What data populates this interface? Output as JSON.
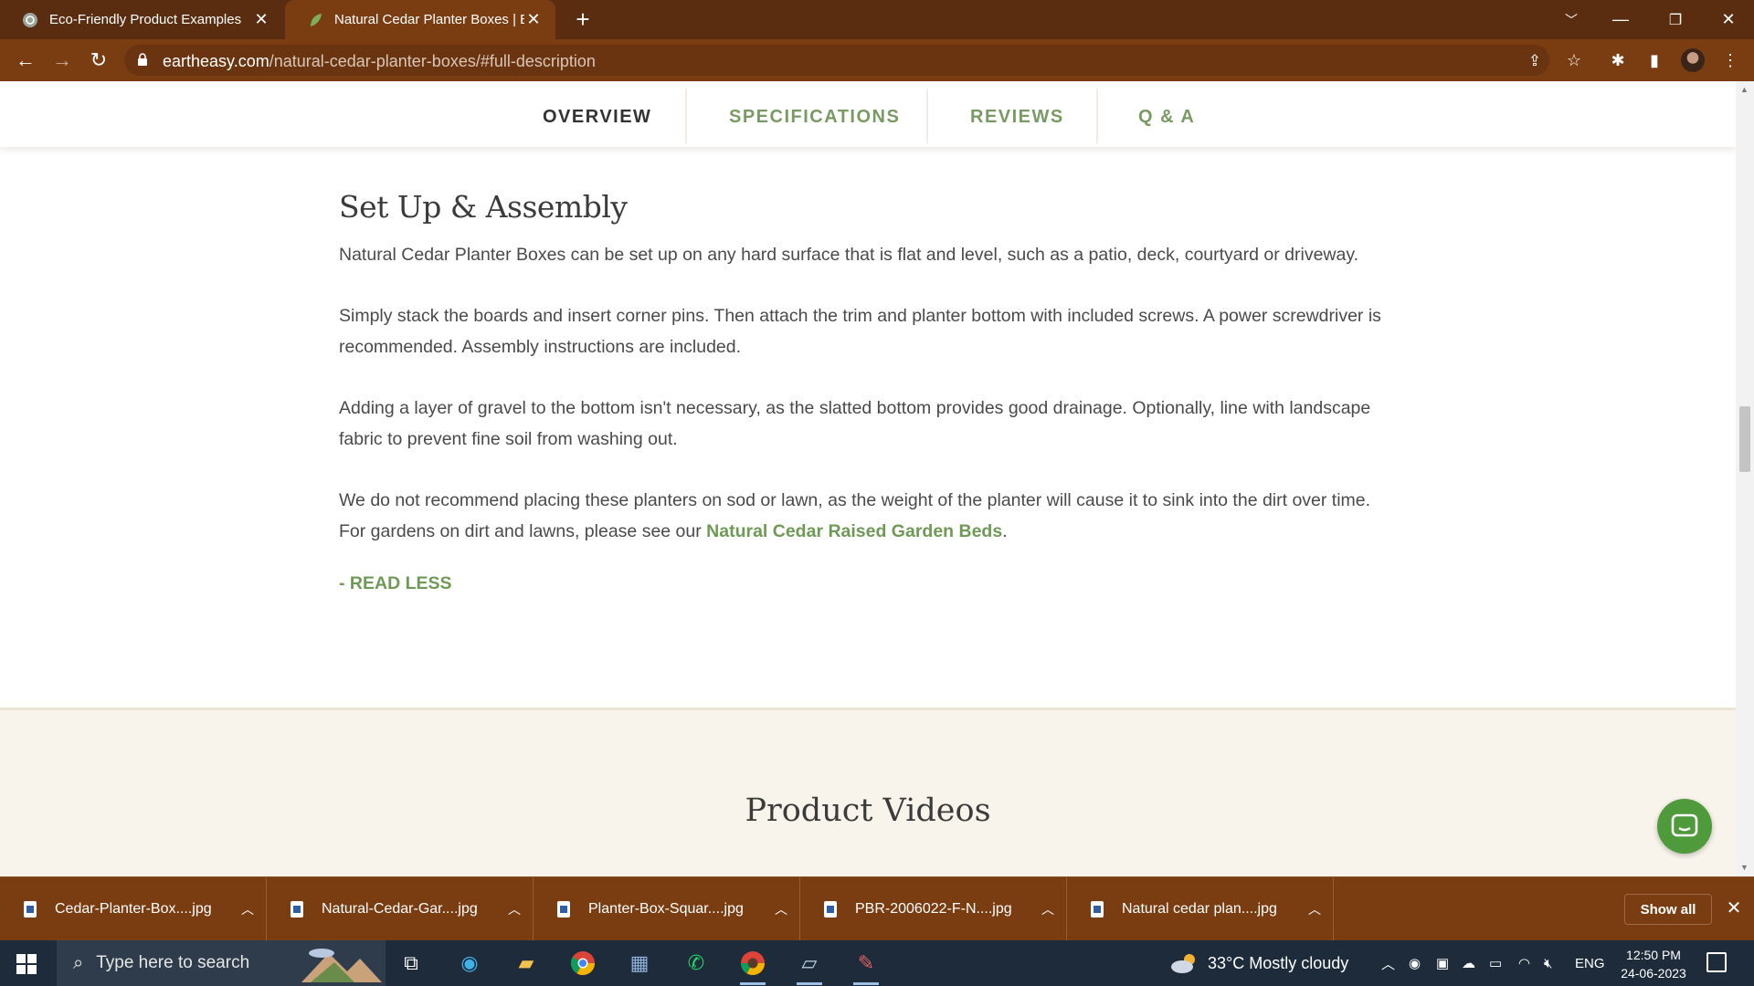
{
  "browser": {
    "tabs": [
      {
        "title": "Eco-Friendly Product Examples",
        "active": false,
        "favicon": "chatgpt-icon"
      },
      {
        "title": "Natural Cedar Planter Boxes | Ear",
        "active": true,
        "favicon": "leaf-icon"
      }
    ],
    "url_domain": "eartheasy.com",
    "url_path": "/natural-cedar-planter-boxes/#full-description"
  },
  "section_nav": {
    "items": [
      "OVERVIEW",
      "SPECIFICATIONS",
      "REVIEWS",
      "Q & A"
    ],
    "active": "OVERVIEW"
  },
  "content": {
    "heading": "Set Up & Assembly",
    "p1": "Natural Cedar Planter Boxes can be set up on any hard surface that is flat and level, such as a patio, deck, courtyard or driveway.",
    "p2": "Simply stack the boards and insert corner pins. Then attach the trim and planter bottom with included screws. A power screwdriver is recommended. Assembly instructions are included.",
    "p3": "Adding a layer of gravel to the bottom isn't necessary, as the slatted bottom provides good drainage. Optionally, line with landscape fabric to prevent fine soil from washing out.",
    "p4_before": "We do not recommend placing these planters on sod or lawn, as the weight of the planter will cause it to sink into the dirt over time. For gardens on dirt and lawns, please see our ",
    "p4_link": "Natural Cedar Raised Garden Beds",
    "p4_after": ".",
    "read_less": "- READ LESS"
  },
  "videos_section": {
    "heading": "Product Videos"
  },
  "downloads": {
    "items": [
      "Cedar-Planter-Box....jpg",
      "Natural-Cedar-Gar....jpg",
      "Planter-Box-Squar....jpg",
      "PBR-2006022-F-N....jpg",
      "Natural cedar plan....jpg"
    ],
    "show_all": "Show all"
  },
  "taskbar": {
    "search_placeholder": "Type here to search",
    "weather": "33°C  Mostly cloudy",
    "language": "ENG",
    "time": "12:50 PM",
    "date": "24-06-2023"
  },
  "colors": {
    "chrome_dark": "#5a2d10",
    "chrome": "#7a3d12",
    "accent_green": "#6f9a56",
    "section_bg": "#f8f4ec",
    "taskbar": "#1d2b3a"
  }
}
